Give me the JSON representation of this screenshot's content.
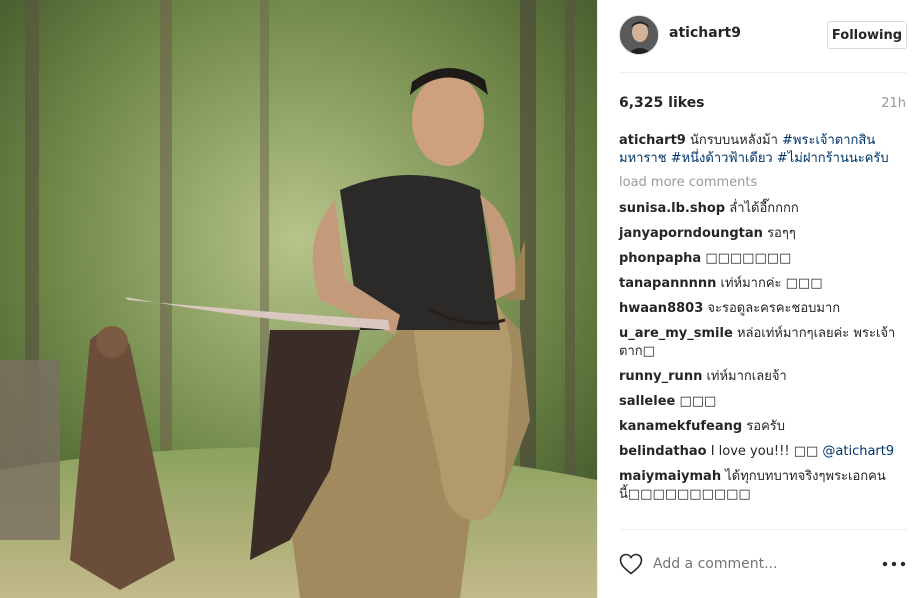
{
  "post": {
    "username": "atichart9",
    "follow_label": "Following",
    "likes": "6,325 likes",
    "time": "21h",
    "caption": {
      "user": "atichart9",
      "text": "นักรบบนหลังม้า ",
      "hashtags": [
        "#พระเจ้าตากสินมหาราช",
        "#หนึ่งด้าวฟ้าเดียว",
        "#ไม่ฝากร้านนะครับ"
      ]
    },
    "load_more": "load more comments",
    "comments": [
      {
        "user": "sunisa.lb.shop",
        "text": "ล่ำได้อี๊กกกก"
      },
      {
        "user": "janyaporndoungtan",
        "text": "รอๆๆ"
      },
      {
        "user": "phonpapha",
        "text": "□□□□□□□"
      },
      {
        "user": "tanapannnnn",
        "text": "เท่ห์มากค่ะ □□□"
      },
      {
        "user": "hwaan8803",
        "text": "จะรอดูละครคะชอบมาก"
      },
      {
        "user": "u_are_my_smile",
        "text": "หล่อเท่ห์มากๆเลยค่ะ พระเจ้าตาก□"
      },
      {
        "user": "runny_runn",
        "text": "เท่ห์มากเลยจ้า"
      },
      {
        "user": "sallelee",
        "text": "□□□"
      },
      {
        "user": "kanamekfufeang",
        "text": "รอครับ"
      },
      {
        "user": "belindathao",
        "text": "I love you!!! □□",
        "mention": "@atichart9"
      },
      {
        "user": "maiymaiymah",
        "text": "ได้ทุกบทบาทจริงๆพระเอกคนนี้□□□□□□□□□□"
      }
    ],
    "add_comment_placeholder": "Add a comment..."
  },
  "icons": {
    "heart": "heart-outline-icon",
    "more": "more-options-icon"
  },
  "colors": {
    "hashtag": "#003569",
    "muted": "#999999",
    "text": "#262626",
    "border": "#dbdbdb"
  }
}
